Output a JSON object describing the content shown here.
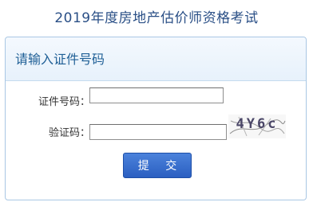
{
  "page": {
    "title": "2019年度房地产估价师资格考试"
  },
  "panel": {
    "title": "请输入证件号码"
  },
  "form": {
    "certificate_label": "证件号码：",
    "certificate_value": "",
    "captcha_label": "验证码：",
    "captcha_value": "",
    "captcha_image_text": "4Y6c",
    "submit_label": "提 交"
  }
}
